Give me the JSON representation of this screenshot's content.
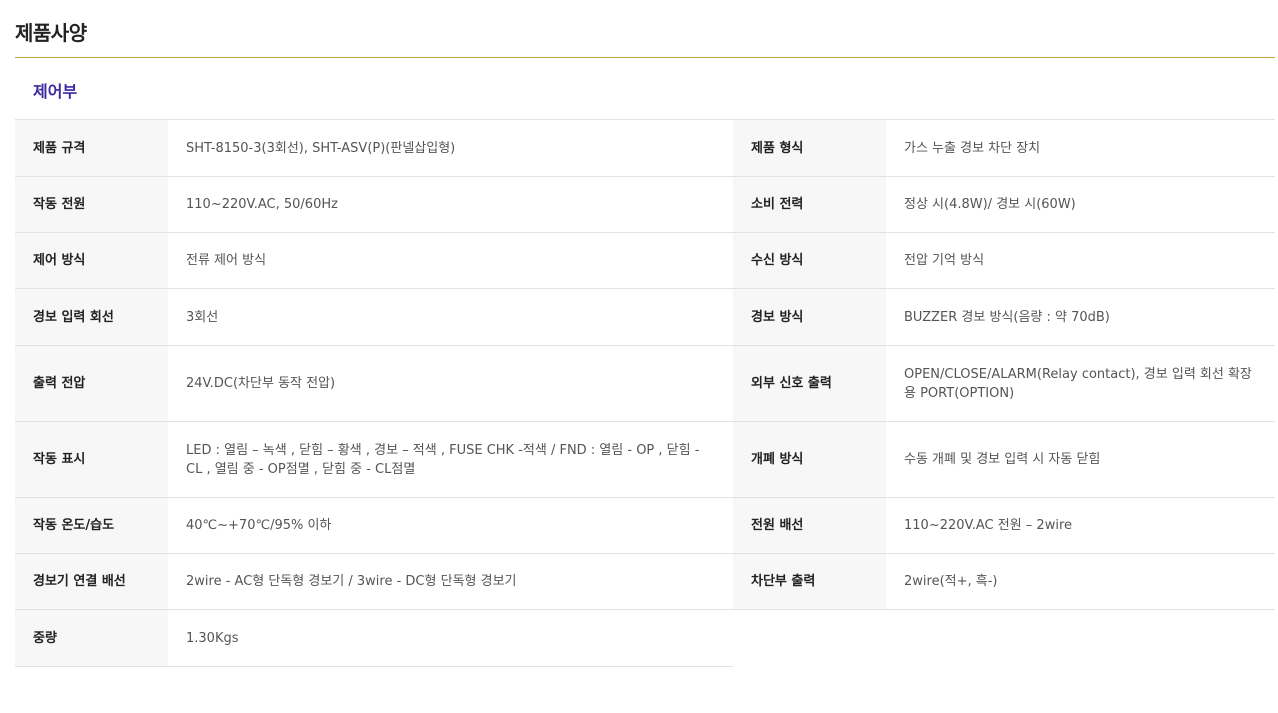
{
  "page_title": "제품사양",
  "section_title": "제어부",
  "colors": {
    "rule": "#c9a43a",
    "section_title": "#3a2aa0",
    "label_bg": "#f7f7f7"
  },
  "rows": [
    {
      "l1": "제품 규격",
      "v1": "SHT-8150-3(3회선), SHT-ASV(P)(판넬삽입형)",
      "l2": "제품 형식",
      "v2": "가스 누출 경보 차단 장치"
    },
    {
      "l1": "작동 전원",
      "v1": "110~220V.AC, 50/60Hz",
      "l2": "소비 전력",
      "v2": "정상 시(4.8W)/ 경보 시(60W)"
    },
    {
      "l1": "제어 방식",
      "v1": "전류 제어 방식",
      "l2": "수신 방식",
      "v2": "전압 기억 방식"
    },
    {
      "l1": "경보 입력 회선",
      "v1": "3회선",
      "l2": "경보 방식",
      "v2": "BUZZER 경보 방식(음량 : 약 70dB)"
    },
    {
      "l1": "출력 전압",
      "v1": "24V.DC(차단부 동작 전압)",
      "l2": "외부 신호 출력",
      "v2": "OPEN/CLOSE/ALARM(Relay contact), 경보 입력 회선 확장용 PORT(OPTION)"
    },
    {
      "l1": "작동 표시",
      "v1": "LED : 열림 – 녹색 , 닫힘 – 황색 , 경보 – 적색 , FUSE CHK  -적색 / FND : 열림 - OP , 닫힘 - CL , 열림 중 - OP점멸 , 닫힘 중 - CL점멸",
      "l2": "개폐 방식",
      "v2": "수동 개폐 및 경보 입력 시 자동 닫힘"
    },
    {
      "l1": "작동 온도/습도",
      "v1": "40℃~+70℃/95% 이하",
      "l2": "전원 배선",
      "v2": "110~220V.AC 전원 – 2wire"
    },
    {
      "l1": "경보기 연결 배선",
      "v1": "2wire - AC형 단독형 경보기 / 3wire - DC형 단독형 경보기",
      "l2": "차단부 출력",
      "v2": "2wire(적+, 흑-)"
    },
    {
      "l1": "중량",
      "v1": "1.30Kgs"
    }
  ]
}
